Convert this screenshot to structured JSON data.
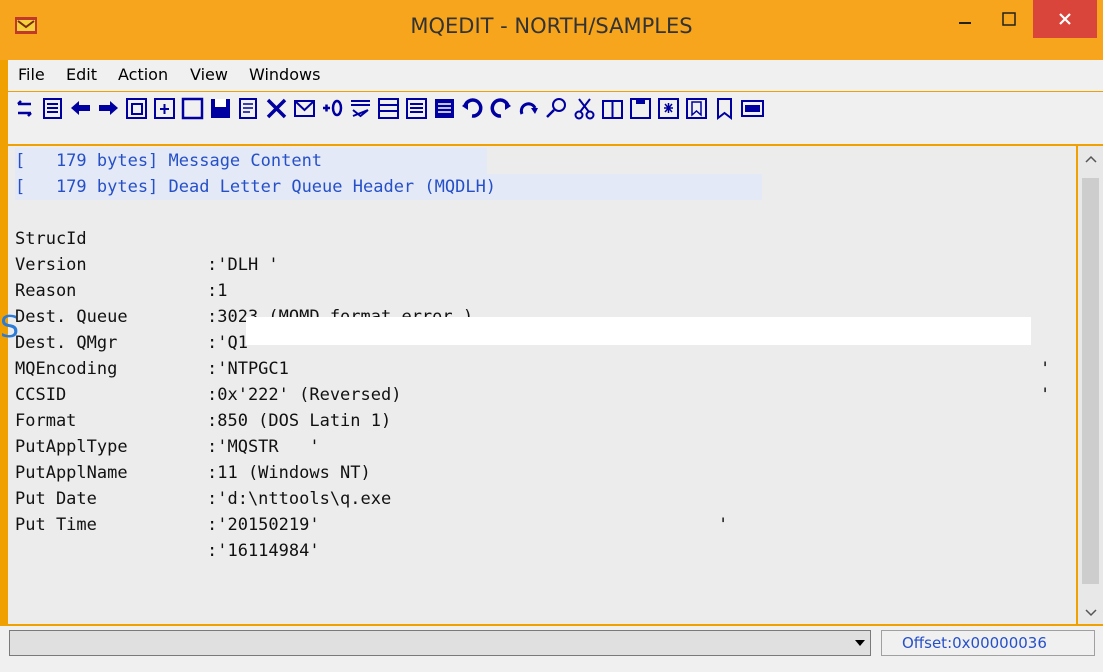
{
  "window": {
    "title": "MQEDIT - NORTH/SAMPLES"
  },
  "menu": [
    {
      "label": "File"
    },
    {
      "label": "Edit"
    },
    {
      "label": "Action"
    },
    {
      "label": "View"
    },
    {
      "label": "Windows"
    }
  ],
  "content": {
    "message_content": "[   179 bytes] Message Content",
    "dlq_header": "[   179 bytes] Dead Letter Queue Header (MQDLH)",
    "fields": [
      {
        "label": "StrucId",
        "value": ":'DLH '"
      },
      {
        "label": "Version",
        "value": ":1"
      },
      {
        "label": "Reason",
        "value": ":3023 (MQMD format error.)"
      },
      {
        "label": "Dest. Queue",
        "value": ":'Q1",
        "close": "'"
      },
      {
        "label": "Dest. QMgr",
        "value": ":'NTPGC1",
        "close": "'"
      },
      {
        "label": "MQEncoding",
        "value": ":0x'222' (Reversed)"
      },
      {
        "label": "CCSID",
        "value": ":850 (DOS Latin 1)"
      },
      {
        "label": "Format",
        "value": ":'MQSTR   '"
      },
      {
        "label": "PutApplType",
        "value": ":11 (Windows NT)"
      },
      {
        "label": "PutApplName",
        "value": ":'d:\\nttools\\q.exe",
        "close": "'"
      },
      {
        "label": "Put Date",
        "value": ":'20150219'"
      },
      {
        "label": "Put Time",
        "value": ":'16114984'"
      }
    ]
  },
  "status": {
    "offset": "Offset:0x00000036"
  },
  "edge_glyph": "S",
  "colors": {
    "titlebar": "#f7a51d",
    "close": "#d9453b",
    "link_blue": "#2650c8"
  }
}
